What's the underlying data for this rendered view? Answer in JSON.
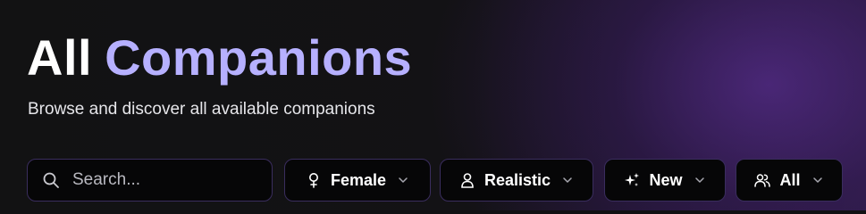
{
  "header": {
    "title_part1": "All",
    "title_part2": "Companions",
    "subtitle": "Browse and discover all available companions"
  },
  "search": {
    "placeholder": "Search...",
    "value": "",
    "icon": "search-icon"
  },
  "filters": [
    {
      "label": "Female",
      "icon": "female-icon"
    },
    {
      "label": "Realistic",
      "icon": "person-icon"
    },
    {
      "label": "New",
      "icon": "sparkles-icon"
    },
    {
      "label": "All",
      "icon": "users-icon"
    }
  ],
  "colors": {
    "background": "#111113",
    "accent": "#b6b0ff",
    "control_border": "#3a2d5e",
    "control_bg": "#060607"
  }
}
